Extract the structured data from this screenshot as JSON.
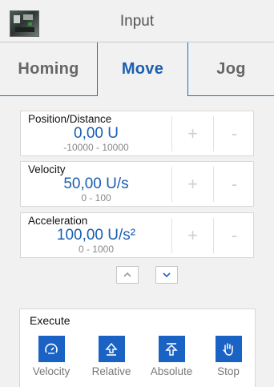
{
  "header": {
    "title": "Input",
    "thumbnail_icon": "machine-thumbnail-icon"
  },
  "tabs": [
    {
      "label": "Homing",
      "active": false
    },
    {
      "label": "Move",
      "active": true
    },
    {
      "label": "Jog",
      "active": false
    }
  ],
  "params": [
    {
      "label": "Position/Distance",
      "value": "0,00 U",
      "range": "-10000  -  10000",
      "plus": "+",
      "minus": "-"
    },
    {
      "label": "Velocity",
      "value": "50,00 U/s",
      "range": "0     -    100",
      "plus": "+",
      "minus": "-"
    },
    {
      "label": "Acceleration",
      "value": "100,00 U/s²",
      "range": "0     -  1000",
      "plus": "+",
      "minus": "-"
    }
  ],
  "nav": {
    "up_icon": "chevron-up-icon",
    "down_icon": "chevron-down-icon"
  },
  "execute": {
    "title": "Execute",
    "buttons": [
      {
        "label": "Velocity",
        "icon": "speedometer-icon"
      },
      {
        "label": "Relative",
        "icon": "relative-arrow-icon"
      },
      {
        "label": "Absolute",
        "icon": "absolute-arrow-icon"
      },
      {
        "label": "Stop",
        "icon": "hand-stop-icon"
      }
    ]
  },
  "colors": {
    "accent": "#1a62c4",
    "value_text": "#1a5fb0",
    "background": "#f1f1f1"
  }
}
